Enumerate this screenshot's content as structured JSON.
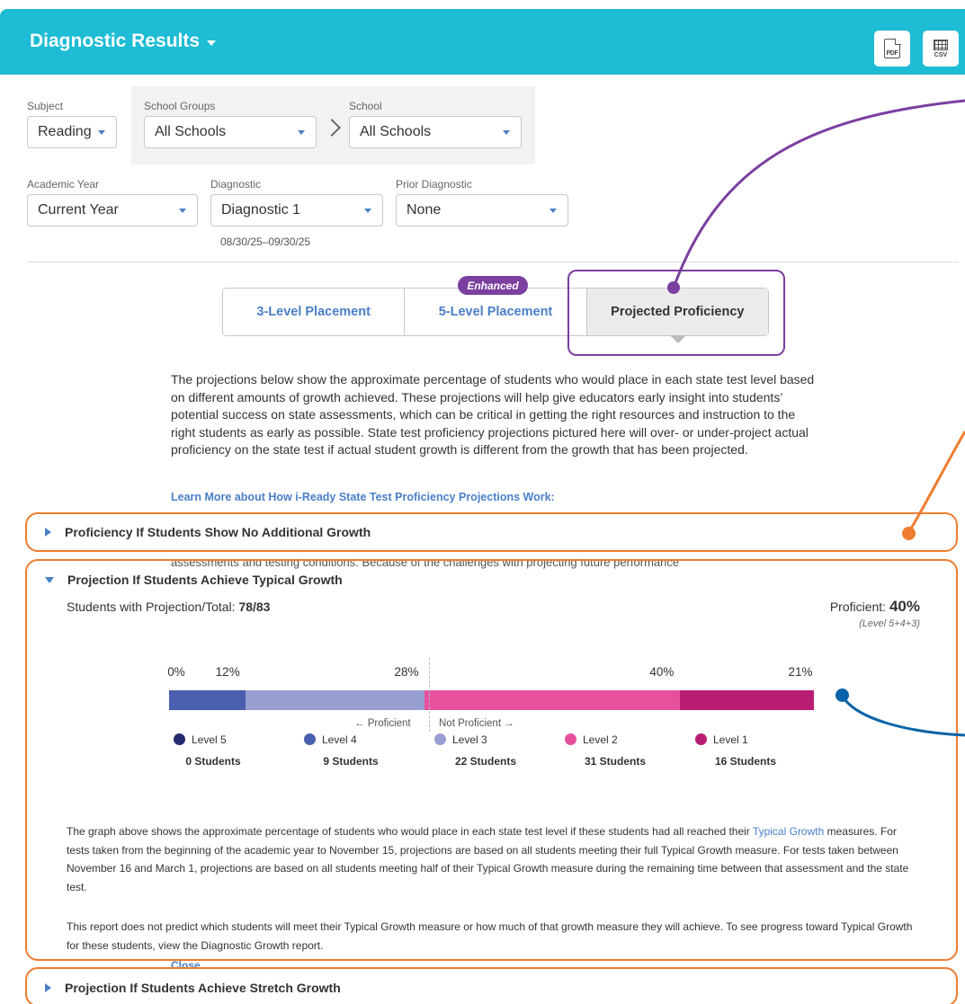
{
  "header": {
    "title": "Diagnostic Results",
    "export_pdf": "PDF",
    "export_csv": "CSV"
  },
  "filters": {
    "subject": {
      "label": "Subject",
      "value": "Reading"
    },
    "school_groups": {
      "label": "School Groups",
      "value": "All Schools"
    },
    "school": {
      "label": "School",
      "value": "All Schools"
    },
    "academic_year": {
      "label": "Academic Year",
      "value": "Current Year"
    },
    "diagnostic": {
      "label": "Diagnostic",
      "value": "Diagnostic 1",
      "date_range": "08/30/25–09/30/25"
    },
    "prior_diagnostic": {
      "label": "Prior Diagnostic",
      "value": "None"
    }
  },
  "tabs": [
    {
      "label": "3-Level Placement"
    },
    {
      "label": "5-Level Placement",
      "badge": "Enhanced"
    },
    {
      "label": "Projected Proficiency",
      "active": true
    }
  ],
  "intro": "The projections below show the approximate percentage of students who would place in each state test level based on different amounts of growth achieved. These projections will help give educators early insight into students’ potential success on state assessments, which can be critical in getting the right resources and instruction to the right students as early as possible. State test proficiency projections pictured here will over- or under-project actual proficiency on the state test if actual student growth is different from the growth that has been projected.",
  "learn_more": "Learn More about How i-Ready State Test Proficiency Projections Work:",
  "sections": {
    "no_growth": {
      "title": "Proficiency If Students Show No Additional Growth"
    },
    "behind_text": "assessments and testing conditions. Because of the challenges with projecting future performance",
    "typical": {
      "title": "Projection If Students Achieve Typical Growth",
      "students_label": "Students with Projection/Total: ",
      "students_value": "78/83",
      "proficient_label": "Proficient: ",
      "proficient_value": "40%",
      "proficient_note": "(Level 5+4+3)",
      "proficient_arrow": "← Proficient",
      "not_proficient_arrow": "Not Proficient →",
      "explain_1a": "The graph above shows the approximate percentage of students who would place in each state test level if these students had all reached their ",
      "explain_1_link": "Typical Growth",
      "explain_1b": " measures. For tests taken from the beginning of the academic year to November 15, projections are based on all students meeting their full Typical Growth measure. For tests taken between November 16 and March 1, projections are based on all students meeting half of their Typical Growth measure during the remaining time between that assessment and the state test.",
      "explain_2": "This report does not predict which students will meet their Typical Growth measure or how much of that growth measure they will achieve. To see progress toward Typical Growth for these students, view the Diagnostic Growth report.",
      "close_label": "Close"
    },
    "stretch": {
      "title": "Projection If Students Achieve Stretch Growth"
    }
  },
  "chart_data": {
    "type": "bar",
    "orientation": "horizontal-stacked",
    "categories": [
      "Level 5",
      "Level 4",
      "Level 3",
      "Level 2",
      "Level 1"
    ],
    "percent_labels": [
      "0%",
      "12%",
      "28%",
      "40%",
      "21%"
    ],
    "values_percent": [
      0,
      12,
      28,
      40,
      21
    ],
    "student_counts": [
      "0 Students",
      "9 Students",
      "22 Students",
      "31 Students",
      "16 Students"
    ],
    "colors": [
      "#232a6e",
      "#4a5fad",
      "#979fd2",
      "#e6519e",
      "#b91e72"
    ]
  },
  "annotation_colors": {
    "purple": "#7b3fa0",
    "orange": "#ee7d30",
    "blue": "#0b64a8"
  }
}
